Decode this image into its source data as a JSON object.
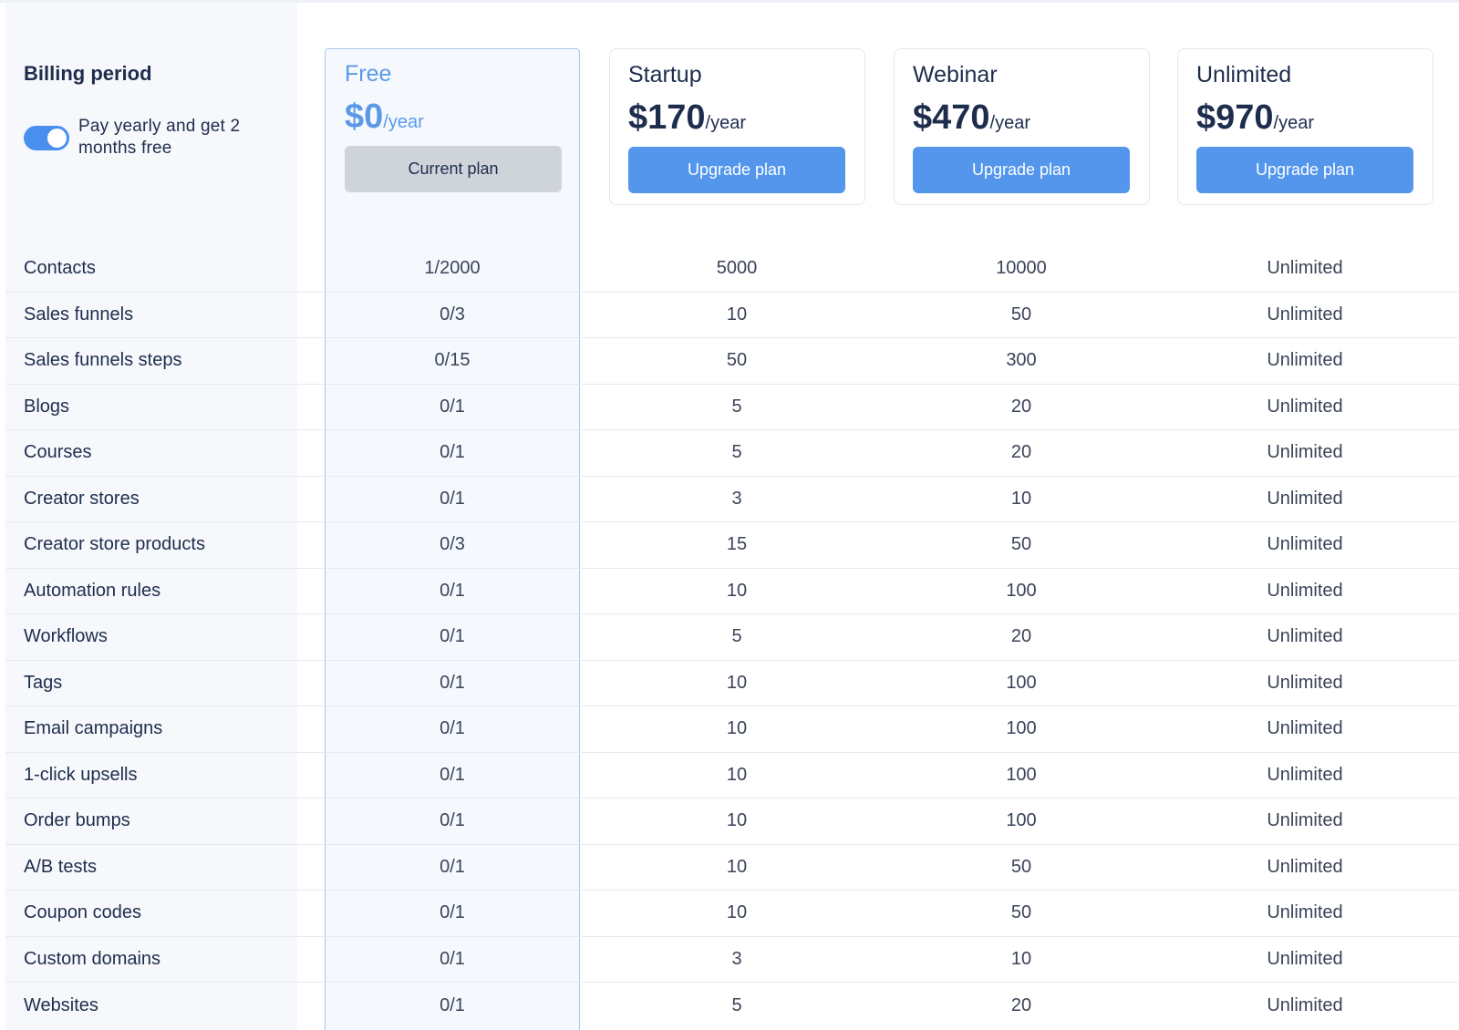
{
  "billing": {
    "title": "Billing period",
    "toggle_label": "Pay yearly and get 2 months free",
    "toggle_on": true
  },
  "plans": [
    {
      "name": "Free",
      "price": "$0",
      "period": "/year",
      "button": "Current plan",
      "current": true
    },
    {
      "name": "Startup",
      "price": "$170",
      "period": "/year",
      "button": "Upgrade plan",
      "current": false
    },
    {
      "name": "Webinar",
      "price": "$470",
      "period": "/year",
      "button": "Upgrade plan",
      "current": false
    },
    {
      "name": "Unlimited",
      "price": "$970",
      "period": "/year",
      "button": "Upgrade plan",
      "current": false
    }
  ],
  "features": [
    {
      "label": "Contacts",
      "values": [
        "1/2000",
        "5000",
        "10000",
        "Unlimited"
      ]
    },
    {
      "label": "Sales funnels",
      "values": [
        "0/3",
        "10",
        "50",
        "Unlimited"
      ]
    },
    {
      "label": "Sales funnels steps",
      "values": [
        "0/15",
        "50",
        "300",
        "Unlimited"
      ]
    },
    {
      "label": "Blogs",
      "values": [
        "0/1",
        "5",
        "20",
        "Unlimited"
      ]
    },
    {
      "label": "Courses",
      "values": [
        "0/1",
        "5",
        "20",
        "Unlimited"
      ]
    },
    {
      "label": "Creator stores",
      "values": [
        "0/1",
        "3",
        "10",
        "Unlimited"
      ]
    },
    {
      "label": "Creator store products",
      "values": [
        "0/3",
        "15",
        "50",
        "Unlimited"
      ]
    },
    {
      "label": "Automation rules",
      "values": [
        "0/1",
        "10",
        "100",
        "Unlimited"
      ]
    },
    {
      "label": "Workflows",
      "values": [
        "0/1",
        "5",
        "20",
        "Unlimited"
      ]
    },
    {
      "label": "Tags",
      "values": [
        "0/1",
        "10",
        "100",
        "Unlimited"
      ]
    },
    {
      "label": "Email campaigns",
      "values": [
        "0/1",
        "10",
        "100",
        "Unlimited"
      ]
    },
    {
      "label": "1-click upsells",
      "values": [
        "0/1",
        "10",
        "100",
        "Unlimited"
      ]
    },
    {
      "label": "Order bumps",
      "values": [
        "0/1",
        "10",
        "100",
        "Unlimited"
      ]
    },
    {
      "label": "A/B tests",
      "values": [
        "0/1",
        "10",
        "50",
        "Unlimited"
      ]
    },
    {
      "label": "Coupon codes",
      "values": [
        "0/1",
        "10",
        "50",
        "Unlimited"
      ]
    },
    {
      "label": "Custom domains",
      "values": [
        "0/1",
        "3",
        "10",
        "Unlimited"
      ]
    },
    {
      "label": "Websites",
      "values": [
        "0/1",
        "5",
        "20",
        "Unlimited"
      ]
    }
  ],
  "colors": {
    "accent": "#5396ec",
    "free_accent": "#5b99e8",
    "text": "#1f2d4d",
    "current_button": "#cfd4db"
  }
}
